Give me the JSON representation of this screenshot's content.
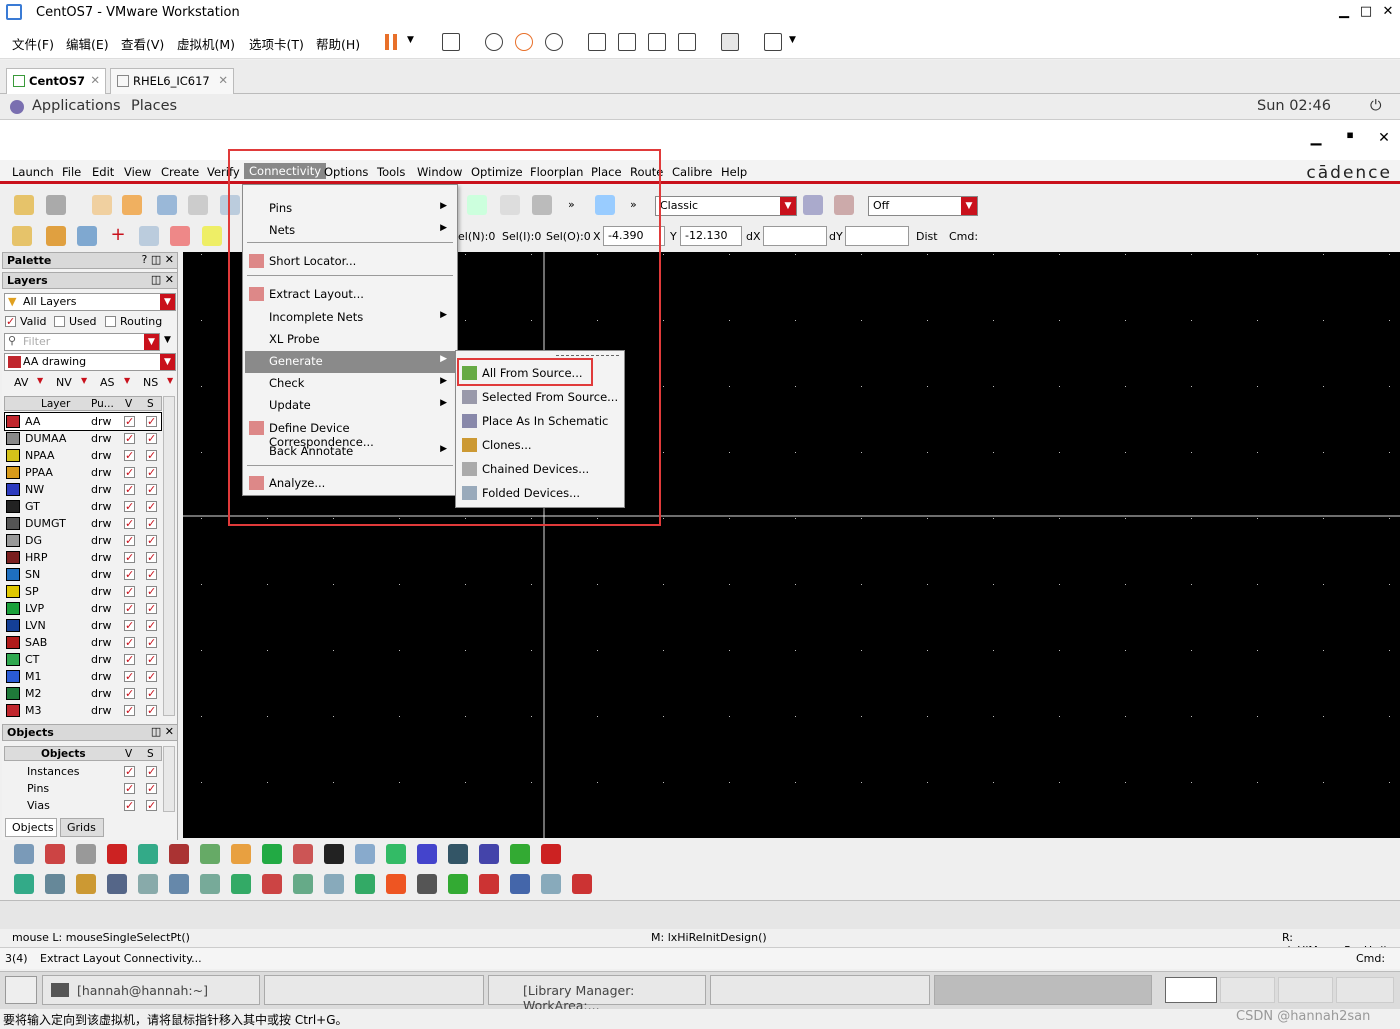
{
  "vmware": {
    "title": "CentOS7 - VMware Workstation",
    "menu": [
      "文件(F)",
      "编辑(E)",
      "查看(V)",
      "虚拟机(M)",
      "选项卡(T)",
      "帮助(H)"
    ],
    "tabs": [
      {
        "label": "CentOS7"
      },
      {
        "label": "RHEL6_IC617"
      }
    ],
    "status_bar": "要将输入定向到该虚拟机，请将鼠标指针移入其中或按 Ctrl+G。",
    "watermark": "CSDN @hannah2san"
  },
  "gnome": {
    "applications": "Applications",
    "places": "Places",
    "clock": "Sun 02:46"
  },
  "virtuoso": {
    "menu": [
      "Launch",
      "File",
      "Edit",
      "View",
      "Create",
      "Verify",
      "Connectivity",
      "Options",
      "Tools",
      "Window",
      "Optimize",
      "Floorplan",
      "Place",
      "Route",
      "Calibre",
      "Help"
    ],
    "brand": "cādence",
    "toolbar": {
      "style_combo": "Classic",
      "off_combo": "Off",
      "sel_n": "el(N):0",
      "sel_i": "Sel(I):0",
      "sel_o": "Sel(O):0",
      "x_label": "X",
      "x_value": "-4.390",
      "y_label": "Y",
      "y_value": "-12.130",
      "dx_label": "dX",
      "dy_label": "dY",
      "dist_label": "Dist",
      "cmd_label": "Cmd:"
    },
    "palette": {
      "title": "Palette",
      "layers_title": "Layers",
      "all_layers": "All Layers",
      "valid": "Valid",
      "used": "Used",
      "routing": "Routing",
      "filter_placeholder": "Filter",
      "lpp": "AA drawing",
      "vis_row": [
        "AV",
        "NV",
        "AS",
        "NS"
      ],
      "table_headers": [
        "Layer",
        "Pu...",
        "V",
        "S"
      ],
      "layers": [
        {
          "name": "AA",
          "purpose": "drw",
          "color": "#c0262d"
        },
        {
          "name": "DUMAA",
          "purpose": "drw",
          "color": "#888888"
        },
        {
          "name": "NPAA",
          "purpose": "drw",
          "color": "#d4c21a"
        },
        {
          "name": "PPAA",
          "purpose": "drw",
          "color": "#d89b1a"
        },
        {
          "name": "NW",
          "purpose": "drw",
          "color": "#2d3bbf"
        },
        {
          "name": "GT",
          "purpose": "drw",
          "color": "#222222"
        },
        {
          "name": "DUMGT",
          "purpose": "drw",
          "color": "#555555"
        },
        {
          "name": "DG",
          "purpose": "drw",
          "color": "#999999"
        },
        {
          "name": "HRP",
          "purpose": "drw",
          "color": "#7a1f1f"
        },
        {
          "name": "SN",
          "purpose": "drw",
          "color": "#1e6fbf"
        },
        {
          "name": "SP",
          "purpose": "drw",
          "color": "#e0c800"
        },
        {
          "name": "LVP",
          "purpose": "drw",
          "color": "#1aa03a"
        },
        {
          "name": "LVN",
          "purpose": "drw",
          "color": "#143f96"
        },
        {
          "name": "SAB",
          "purpose": "drw",
          "color": "#b01a1a"
        },
        {
          "name": "CT",
          "purpose": "drw",
          "color": "#2fa84f"
        },
        {
          "name": "M1",
          "purpose": "drw",
          "color": "#2a5bd6"
        },
        {
          "name": "M2",
          "purpose": "drw",
          "color": "#1f7a3a"
        },
        {
          "name": "M3",
          "purpose": "drw",
          "color": "#c0262d"
        }
      ],
      "objects_title": "Objects",
      "objects_headers": [
        "Objects",
        "V",
        "S"
      ],
      "objects": [
        "Instances",
        "Pins",
        "Vias"
      ],
      "bottom_tabs": [
        "Objects",
        "Grids"
      ]
    },
    "connectivity_menu": [
      {
        "label": "Pins",
        "submenu": true
      },
      {
        "label": "Nets",
        "submenu": true
      },
      {
        "label": "Short Locator...",
        "icon": "short-locator-icon"
      },
      {
        "label": "Extract Layout...",
        "icon": "extract-icon"
      },
      {
        "label": "Incomplete Nets",
        "submenu": true
      },
      {
        "label": "XL Probe"
      },
      {
        "label": "Generate",
        "submenu": true
      },
      {
        "label": "Check",
        "submenu": true
      },
      {
        "label": "Update",
        "submenu": true
      },
      {
        "label": "Define Device Correspondence...",
        "icon": "device-correspondence-icon"
      },
      {
        "label": "Back Annotate",
        "submenu": true
      },
      {
        "label": "Analyze...",
        "icon": "analyze-icon"
      }
    ],
    "generate_submenu": [
      {
        "label": "All From Source...",
        "icon": "all-from-source-icon"
      },
      {
        "label": "Selected From Source...",
        "icon": "selected-from-source-icon"
      },
      {
        "label": "Place As In Schematic",
        "icon": "place-as-schematic-icon"
      },
      {
        "label": "Clones...",
        "icon": "clones-icon"
      },
      {
        "label": "Chained Devices...",
        "icon": "chained-devices-icon"
      },
      {
        "label": "Folded Devices...",
        "icon": "folded-devices-icon"
      }
    ],
    "mouse_left": "mouse L: mouseSingleSelectPt()",
    "mouse_mid": "M: lxHiReInitDesign()",
    "mouse_right": "R: _lxHiMousePopUp()",
    "status_num": "3(4)",
    "status_text": "Extract Layout Connectivity...",
    "status_cmd": "Cmd:"
  },
  "taskbar": {
    "items": [
      "[hannah@hannah:~]",
      "[Library Manager: WorkArea:..."
    ]
  }
}
